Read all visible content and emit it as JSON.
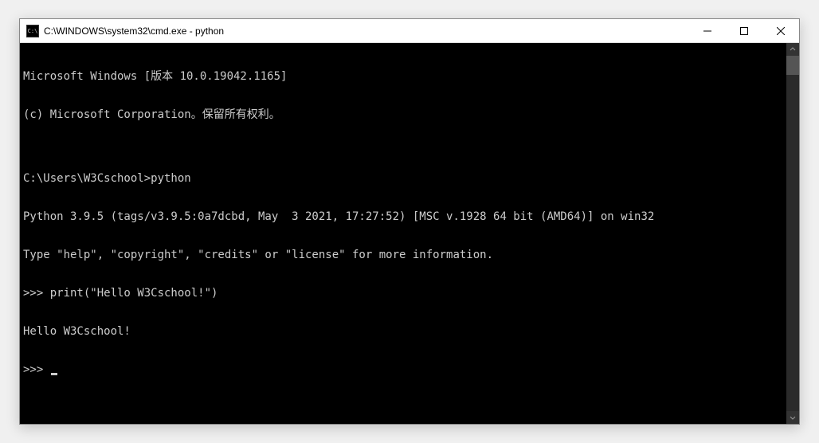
{
  "window": {
    "icon_label": "C:\\",
    "title": "C:\\WINDOWS\\system32\\cmd.exe - python"
  },
  "terminal": {
    "lines": [
      "Microsoft Windows [版本 10.0.19042.1165]",
      "(c) Microsoft Corporation。保留所有权利。",
      "",
      "C:\\Users\\W3Cschool>python",
      "Python 3.9.5 (tags/v3.9.5:0a7dcbd, May  3 2021, 17:27:52) [MSC v.1928 64 bit (AMD64)] on win32",
      "Type \"help\", \"copyright\", \"credits\" or \"license\" for more information.",
      ">>> print(\"Hello W3Cschool!\")",
      "Hello W3Cschool!"
    ],
    "prompt": ">>> "
  }
}
